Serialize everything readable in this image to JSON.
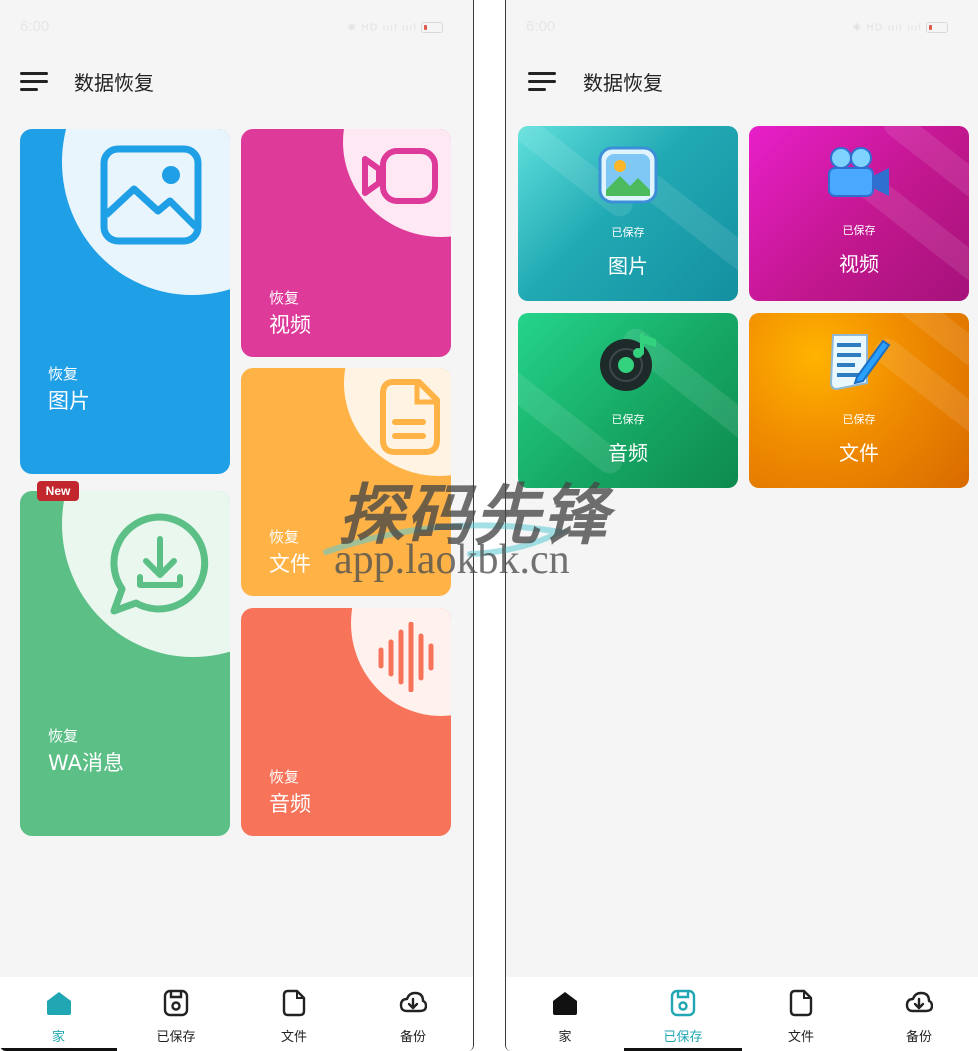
{
  "status_bar": {
    "time": "6:00",
    "icons": "✱ HD ıııl ıııl"
  },
  "app_bar": {
    "title": "数据恢复"
  },
  "recover_tiles": {
    "photos": {
      "small": "恢复",
      "big": "图片"
    },
    "videos": {
      "small": "恢复",
      "big": "视频"
    },
    "files": {
      "small": "恢复",
      "big": "文件"
    },
    "wa": {
      "small": "恢复",
      "big": "WA消息",
      "badge": "New"
    },
    "audio": {
      "small": "恢复",
      "big": "音频"
    }
  },
  "saved_tiles": {
    "photos": {
      "small": "已保存",
      "big": "图片"
    },
    "videos": {
      "small": "已保存",
      "big": "视频"
    },
    "audio": {
      "small": "已保存",
      "big": "音频"
    },
    "files": {
      "small": "已保存",
      "big": "文件"
    }
  },
  "bottom_nav": {
    "home": "家",
    "saved": "已保存",
    "files": "文件",
    "backup": "备份"
  },
  "watermark": {
    "cn": "探码先锋",
    "url": "app.laokbk.cn"
  },
  "colors": {
    "accent": "#21a6b3",
    "blue": "#1f9fe6",
    "magenta": "#dd3a9a",
    "yellow": "#ffb347",
    "green": "#5bbf86",
    "coral": "#f7745a"
  }
}
